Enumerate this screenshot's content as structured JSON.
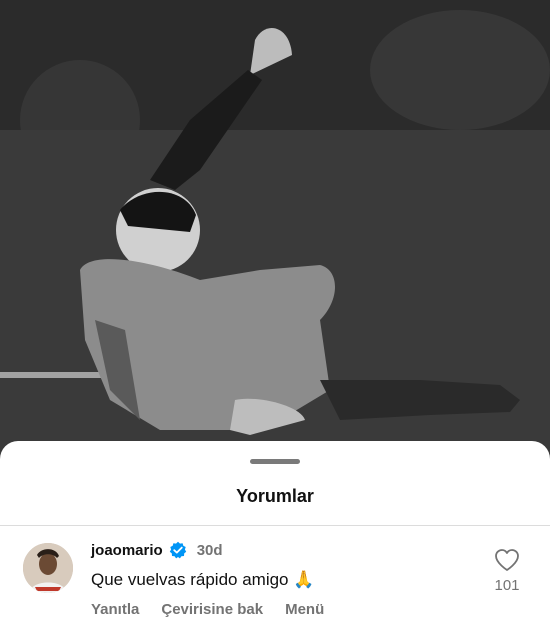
{
  "sheet": {
    "title": "Yorumlar"
  },
  "comment": {
    "username": "joaomario",
    "verified": true,
    "time": "30d",
    "text": "Que vuelvas rápido amigo 🙏",
    "actions": {
      "reply": "Yanıtla",
      "translate": "Çevirisine bak",
      "menu": "Menü"
    },
    "like_count": "101"
  },
  "colors": {
    "sheet_bg": "#ffffff",
    "muted_text": "#737373",
    "verified_blue": "#0095f6"
  },
  "icons": {
    "verified": "verified-icon",
    "like": "heart-icon"
  }
}
